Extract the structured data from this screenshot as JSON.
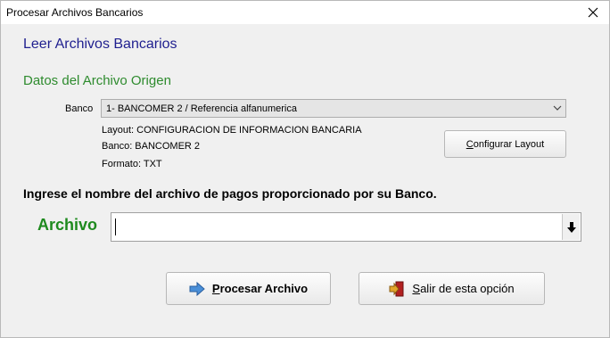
{
  "window": {
    "title": "Procesar Archivos Bancarios",
    "close_icon": "close-icon"
  },
  "header": {
    "title": "Leer Archivos Bancarios",
    "section": "Datos del Archivo Origen"
  },
  "banco": {
    "label": "Banco",
    "selected": "1- BANCOMER 2 / Referencia alfanumerica",
    "info_layout": "Layout: CONFIGURACION DE INFORMACION BANCARIA",
    "info_banco": "Banco: BANCOMER 2",
    "info_formato": "Formato: TXT",
    "config_button": {
      "accel": "C",
      "rest": "onfigurar Layout"
    }
  },
  "archivo": {
    "prompt": "Ingrese el nombre del archivo de pagos proporcionado por su Banco.",
    "label": "Archivo",
    "value": ""
  },
  "actions": {
    "procesar": {
      "accel": "P",
      "rest": "rocesar Archivo",
      "icon": "arrow-right-icon"
    },
    "salir": {
      "accel": "S",
      "rest": "alir de esta opción",
      "icon": "exit-door-icon"
    }
  },
  "colors": {
    "heading": "#1f1f8f",
    "section": "#2e8b2e",
    "archivo_label": "#1e8a1e"
  }
}
